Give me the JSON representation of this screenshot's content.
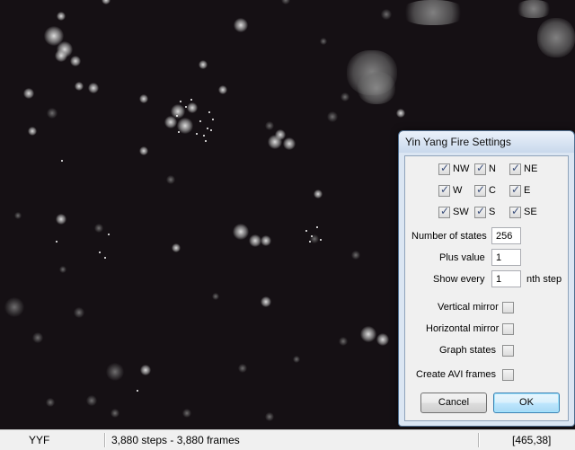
{
  "dialog": {
    "title": "Yin Yang Fire Settings",
    "neighbors": [
      {
        "label": "NW",
        "checked": true
      },
      {
        "label": "N",
        "checked": true
      },
      {
        "label": "NE",
        "checked": true
      },
      {
        "label": "W",
        "checked": true
      },
      {
        "label": "C",
        "checked": true
      },
      {
        "label": "E",
        "checked": true
      },
      {
        "label": "SW",
        "checked": true
      },
      {
        "label": "S",
        "checked": true
      },
      {
        "label": "SE",
        "checked": true
      }
    ],
    "num_states_label": "Number of states",
    "num_states_value": "256",
    "plus_label": "Plus value",
    "plus_value": "1",
    "show_every_label": "Show every",
    "show_every_value": "1",
    "show_every_suffix": "nth step",
    "vertical_mirror_label": "Vertical mirror",
    "vertical_mirror_checked": false,
    "horizontal_mirror_label": "Horizontal mirror",
    "horizontal_mirror_checked": false,
    "graph_states_label": "Graph states",
    "graph_states_checked": false,
    "avi_label": "Create AVI frames",
    "avi_checked": false,
    "cancel_label": "Cancel",
    "ok_label": "OK"
  },
  "status": {
    "rule": "YYF",
    "progress": "3,880 steps - 3,880 frames",
    "coords": "[465,38]"
  },
  "colors": {
    "canvas_bg": "#151014",
    "dialog_frame": "#dbe6f3",
    "ok_button": "#bee6fd"
  },
  "icons": {
    "check_mark": "check-icon"
  }
}
